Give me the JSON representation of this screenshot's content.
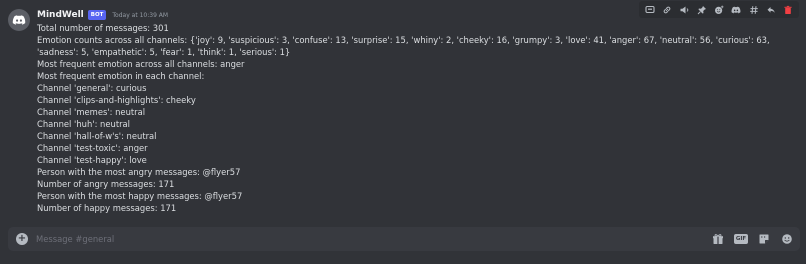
{
  "message": {
    "author": "MindWell",
    "badge": "BOT",
    "timestamp": "Today at 10:39 AM",
    "lines": [
      "Total number of messages: 301",
      "Emotion counts across all channels: {'joy': 9, 'suspicious': 3, 'confuse': 13, 'surprise': 15, 'whiny': 2, 'cheeky': 16, 'grumpy': 3, 'love': 41, 'anger': 67, 'neutral': 56, 'curious': 63, 'sadness': 5, 'empathetic': 5, 'fear': 1, 'think': 1, 'serious': 1}",
      "Most frequent emotion across all channels: anger",
      "Most frequent emotion in each channel:",
      "Channel 'general': curious",
      "Channel 'clips-and-highlights': cheeky",
      "Channel 'memes': neutral",
      "Channel 'huh': neutral",
      "Channel 'hall-of-w's': neutral",
      "Channel 'test-toxic': anger",
      "Channel 'test-happy': love",
      "Person with the most angry messages: @flyer57",
      "Number of angry messages: 171",
      "Person with the most happy messages: @flyer57",
      "Number of happy messages: 171"
    ]
  },
  "toolbar": {
    "icons": [
      "reply-thread-icon",
      "link-icon",
      "speaker-icon",
      "pin-icon",
      "add-reaction-icon",
      "discord-icon",
      "hashtag-icon",
      "reply-icon",
      "delete-icon"
    ]
  },
  "composer": {
    "placeholder": "Message #general",
    "icons": [
      "gift-icon",
      "gif-icon",
      "sticker-icon",
      "emoji-icon"
    ],
    "gif_label": "GIF"
  },
  "colors": {
    "background": "#313338",
    "accent": "#5865f2",
    "delete": "#f23f43",
    "text": "#dbdee1"
  }
}
